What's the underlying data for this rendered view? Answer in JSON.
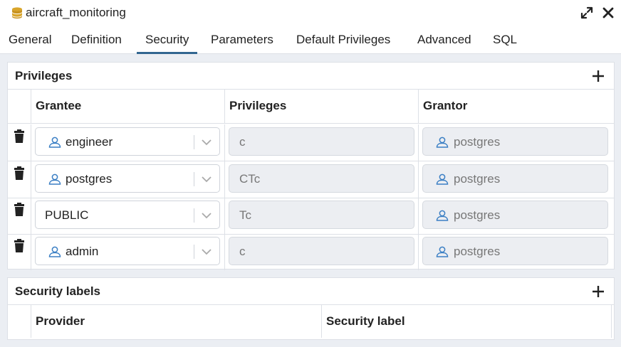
{
  "window": {
    "title": "aircraft_monitoring",
    "icon": "database-icon",
    "controls": [
      "expand-icon",
      "close-icon"
    ]
  },
  "tabs": [
    {
      "label": "General",
      "active": false
    },
    {
      "label": "Definition",
      "active": false
    },
    {
      "label": "Security",
      "active": true
    },
    {
      "label": "Parameters",
      "active": false
    },
    {
      "label": "Default Privileges",
      "active": false
    },
    {
      "label": "Advanced",
      "active": false
    },
    {
      "label": "SQL",
      "active": false
    }
  ],
  "privileges": {
    "title": "Privileges",
    "columns": [
      "Grantee",
      "Privileges",
      "Grantor"
    ],
    "rows": [
      {
        "grantee": "engineer",
        "grantee_is_user": true,
        "privileges": "c",
        "grantor": "postgres"
      },
      {
        "grantee": "postgres",
        "grantee_is_user": true,
        "privileges": "CTc",
        "grantor": "postgres"
      },
      {
        "grantee": "PUBLIC",
        "grantee_is_user": false,
        "privileges": "Tc",
        "grantor": "postgres"
      },
      {
        "grantee": "admin",
        "grantee_is_user": true,
        "privileges": "c",
        "grantor": "postgres"
      }
    ]
  },
  "security_labels": {
    "title": "Security labels",
    "columns": [
      "Provider",
      "Security label"
    ]
  },
  "colors": {
    "accent": "#326690",
    "user_icon": "#3b7fc4",
    "border": "#dde0e6",
    "readonly_bg": "#eceef2",
    "page_bg": "#ebeef3"
  }
}
